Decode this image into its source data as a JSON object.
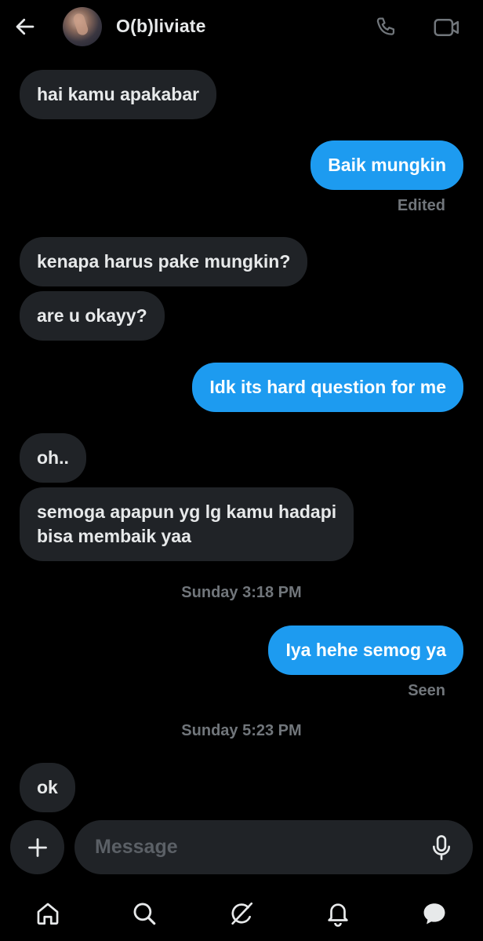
{
  "header": {
    "contact_name": "O(b)liviate",
    "icons": {
      "back": "arrow-left-icon",
      "call": "phone-icon",
      "video": "video-icon"
    }
  },
  "messages": [
    {
      "direction": "incoming",
      "text": "hai kamu apakabar"
    },
    {
      "direction": "outgoing",
      "text": "Baik mungkin",
      "status": "Edited"
    },
    {
      "direction": "incoming",
      "text": "kenapa harus pake mungkin?"
    },
    {
      "direction": "incoming",
      "text": "are u okayy?"
    },
    {
      "direction": "outgoing",
      "text": "Idk its hard question for me"
    },
    {
      "direction": "incoming",
      "text": "oh.."
    },
    {
      "direction": "incoming",
      "text_line1": "semoga apapun yg lg kamu hadapi",
      "text_line2": "bisa membaik yaa"
    },
    {
      "timestamp": "Sunday 3:18 PM"
    },
    {
      "direction": "outgoing",
      "text": "Iya hehe semog ya",
      "status": "Seen"
    },
    {
      "timestamp": "Sunday 5:23 PM"
    },
    {
      "direction": "incoming",
      "text": "ok"
    }
  ],
  "composer": {
    "placeholder": "Message",
    "value": ""
  },
  "nav": [
    "home-icon",
    "search-icon",
    "grok-icon",
    "notifications-icon",
    "messages-icon"
  ],
  "colors": {
    "background": "#000000",
    "incoming_bubble": "#202327",
    "outgoing_bubble": "#1d9bf0",
    "muted_text": "#71767b"
  }
}
